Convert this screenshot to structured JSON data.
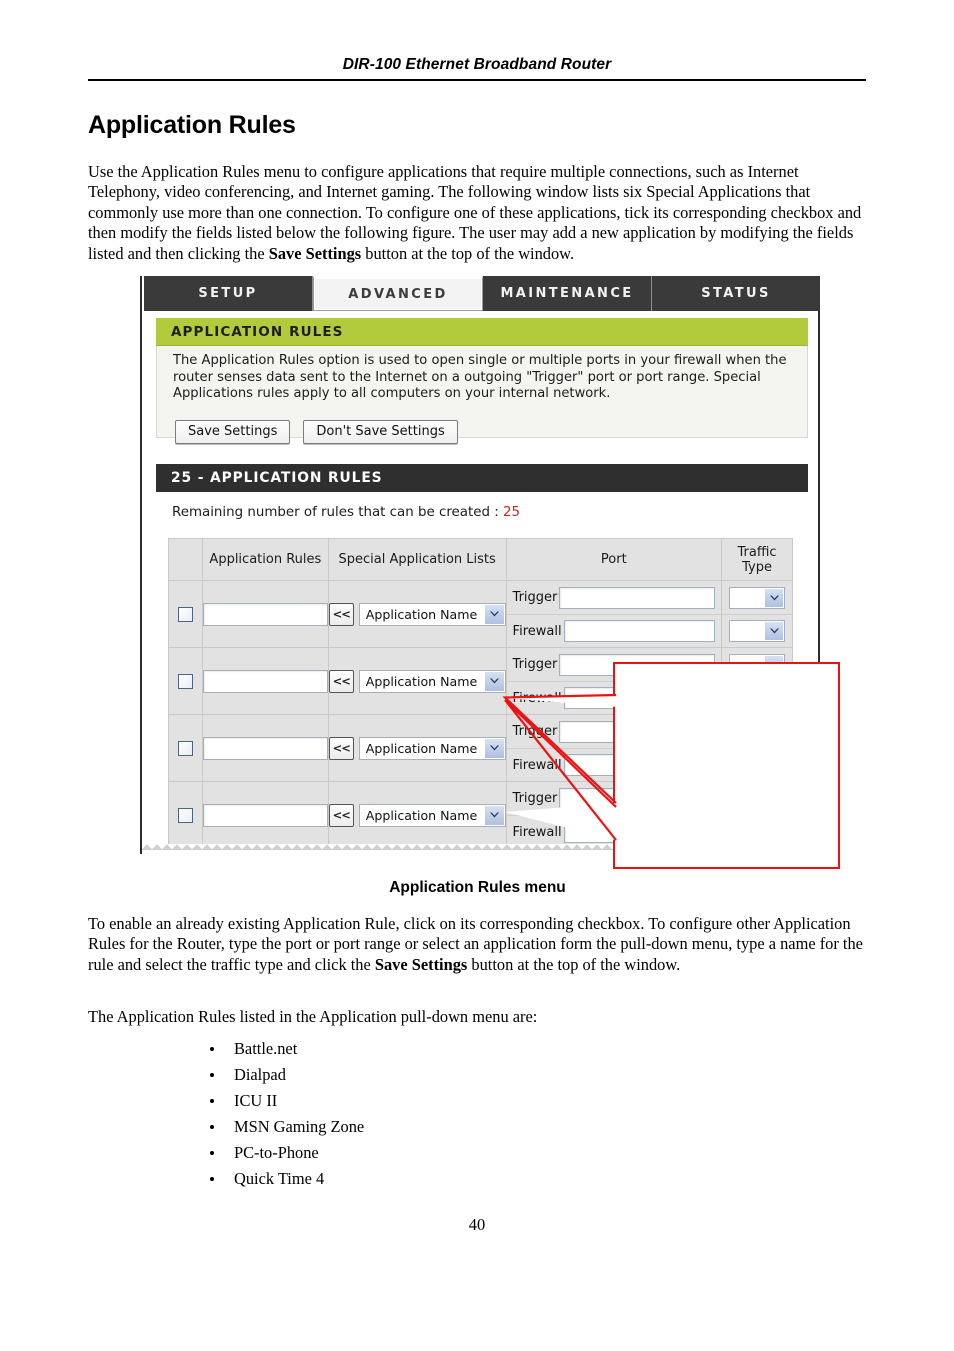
{
  "document": {
    "running_header": "DIR-100 Ethernet Broadband Router",
    "page_number": "40",
    "title": "Application Rules",
    "intro_paragraph": "Use the Application Rules menu to configure applications that require multiple connections, such as Internet Telephony, video conferencing, and Internet gaming. The following window lists six Special Applications that commonly use more than one connection. To configure one of these applications, tick its corresponding checkbox and then modify the fields listed below the following figure. The user may add a new application by modifying the fields listed and then clicking the ",
    "intro_bold": "Save Settings",
    "intro_paragraph_tail": " button at the top of the window.",
    "figure_caption": "Application Rules menu",
    "enable_paragraph": "To enable an already existing Application Rule, click on its corresponding checkbox. To configure other Application Rules for the Router, type the port or port range or select an application form the pull-down menu, type a name for the rule and select the traffic type and click the ",
    "enable_bold": "Save Settings",
    "enable_paragraph_tail": " button at the top of the window.",
    "list_intro": "The Application Rules listed in the Application pull-down menu are:",
    "application_list": [
      "Battle.net",
      "Dialpad",
      "ICU II",
      "MSN Gaming Zone",
      "PC-to-Phone",
      "Quick Time 4"
    ]
  },
  "screenshot": {
    "tabs": [
      {
        "label": "SETUP",
        "active": false
      },
      {
        "label": "ADVANCED",
        "active": true
      },
      {
        "label": "MAINTENANCE",
        "active": false
      },
      {
        "label": "STATUS",
        "active": false
      }
    ],
    "section_header": "APPLICATION RULES",
    "section_description": "The Application Rules option is used to open single or multiple ports in your firewall when the router senses data sent to the Internet on a outgoing \"Trigger\" port or port range. Special Applications rules apply to all computers on your internal network.",
    "buttons": {
      "save": "Save Settings",
      "dont_save": "Don't Save Settings"
    },
    "rules_header": "25 - APPLICATION RULES",
    "remaining_label": "Remaining number of rules that can be created : ",
    "remaining_count": "25",
    "table": {
      "headers": [
        "",
        "Application Rules",
        "Special Application Lists",
        "Port",
        "Traffic Type"
      ],
      "port_labels": {
        "trigger": "Trigger",
        "firewall": "Firewall"
      },
      "select_default": "Application Name",
      "copy_button": "<<",
      "rows": [
        {
          "checked": false,
          "rule_name": "",
          "application": "Application Name",
          "trigger_port": "",
          "firewall_port": "",
          "trigger_type": "",
          "firewall_type": ""
        },
        {
          "checked": false,
          "rule_name": "",
          "application": "Application Name",
          "trigger_port": "",
          "firewall_port": "",
          "trigger_type": "",
          "firewall_type": ""
        },
        {
          "checked": false,
          "rule_name": "",
          "application": "Application Name",
          "trigger_port": "",
          "firewall_port": "",
          "trigger_type": "",
          "firewall_type": ""
        },
        {
          "checked": false,
          "rule_name": "",
          "application": "Application Name",
          "trigger_port": "",
          "firewall_port": "",
          "trigger_type": "",
          "firewall_type": ""
        }
      ]
    }
  },
  "annotation": {
    "callout_text": "",
    "callout_color": "#ee1111"
  },
  "colors": {
    "tab_bar": "#3a3a3a",
    "accent_green": "#b2cb3d",
    "dark_header": "#2f2f2f",
    "count_red": "#cc2222",
    "callout_red": "#ee1111"
  }
}
